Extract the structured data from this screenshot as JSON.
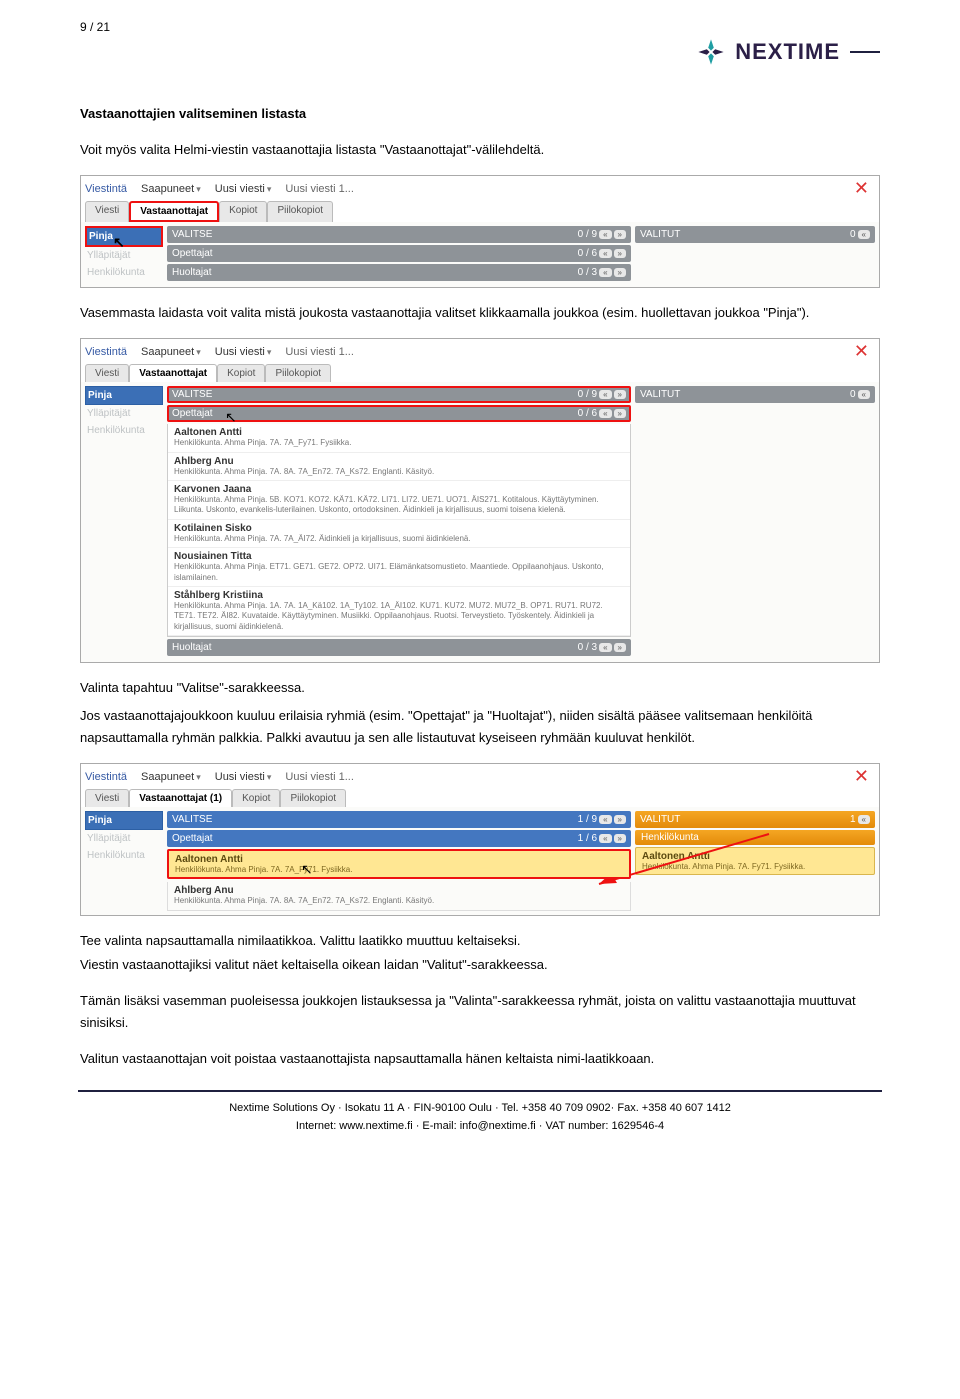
{
  "pagenum": "9 / 21",
  "brand": "NEXTIME",
  "section_title": "Vastaanottajien valitseminen listasta",
  "intro": "Voit myös valita Helmi-viestin vastaanottajia listasta \"Vastaanottajat\"-välilehdeltä.",
  "para2": "Vasemmasta laidasta voit valita mistä joukosta vastaanottajia valitset klikkaamalla joukkoa (esim. huollettavan joukkoa \"Pinja\").",
  "para3a": "Valinta tapahtuu \"Valitse\"-sarakkeessa.",
  "para3b": "Jos vastaanottajajoukkoon kuuluu erilaisia ryhmiä (esim. \"Opettajat\" ja \"Huoltajat\"), niiden sisältä pääsee valitsemaan henkilöitä napsauttamalla ryhmän palkkia. Palkki avautuu ja sen alle listautuvat kyseiseen ryhmään kuuluvat henkilöt.",
  "para4a": "Tee valinta napsauttamalla nimilaatikkoa. Valittu laatikko muuttuu keltaiseksi.",
  "para4b": "Viestin vastaanottajiksi valitut näet keltaisella oikean laidan \"Valitut\"-sarakkeessa.",
  "para5": "Tämän lisäksi vasemman puoleisessa joukkojen listauksessa ja \"Valinta\"-sarakkeessa ryhmät, joista on valittu vastaanottajia muuttuvat sinisiksi.",
  "para6": "Valitun vastaanottajan voit poistaa vastaanottajista napsauttamalla hänen keltaista nimi-laatikkoaan.",
  "ui": {
    "viestinta": "Viestintä",
    "saapuneet": "Saapuneet",
    "uusi": "Uusi viesti",
    "uusi1": "Uusi viesti 1...",
    "viesti": "Viesti",
    "vastaanottajat": "Vastaanottajat",
    "vastaanottajat1": "Vastaanottajat (1)",
    "kopiot": "Kopiot",
    "piilokopiot": "Piilokopiot",
    "valitse": "VALITSE",
    "valitut": "VALITUT",
    "pinja": "Pinja",
    "ylapitajat": "Ylläpitäjät",
    "henkilokunta": "Henkilökunta",
    "opettajat": "Opettajat",
    "huoltajat": "Huoltajat",
    "c09": "0 / 9",
    "c19": "1 / 9",
    "c06": "0 / 6",
    "c16": "1 / 6",
    "c03": "0 / 3",
    "z0": "0",
    "z1": "1"
  },
  "teachers": [
    {
      "name": "Aaltonen Antti",
      "sub": "Henkilökunta. Ahma Pinja. 7A. 7A_Fy71. Fysiikka."
    },
    {
      "name": "Ahlberg Anu",
      "sub": "Henkilökunta. Ahma Pinja. 7A. 8A. 7A_En72. 7A_Ks72. Englanti. Käsityö."
    },
    {
      "name": "Karvonen Jaana",
      "sub": "Henkilökunta. Ahma Pinja. 5B. KO71. KO72. KÄ71. KÄ72. LI71. LI72. UE71. UO71. ÄIS271. Kotitalous. Käyttäytyminen. Liikunta. Uskonto, evankelis-luterilainen. Uskonto, ortodoksinen. Äidinkieli ja kirjallisuus, suomi toisena kielenä."
    },
    {
      "name": "Kotilainen Sisko",
      "sub": "Henkilökunta. Ahma Pinja. 7A. 7A_ÄI72. Äidinkieli ja kirjallisuus, suomi äidinkielenä."
    },
    {
      "name": "Nousiainen Titta",
      "sub": "Henkilökunta. Ahma Pinja. ET71. GE71. GE72. OP72. UI71. Elämänkatsomustieto. Maantiede. Oppilaanohjaus. Uskonto, islamilainen."
    },
    {
      "name": "Ståhlberg Kristiina",
      "sub": "Henkilökunta. Ahma Pinja. 1A. 7A. 1A_Kä102. 1A_Ty102. 1A_ÄI102. KU71. KU72. MU72. MU72_B. OP71. RU71. RU72. TE71. TE72. ÄI82. Kuvataide. Käyttäytyminen. Musiikki. Oppilaanohjaus. Ruotsi. Terveystieto. Työskentely. Äidinkieli ja kirjallisuus, suomi äidinkielenä."
    }
  ],
  "shot3": {
    "aaltonen_name": "Aaltonen Antti",
    "aaltonen_sub": "Henkilökunta. Ahma Pinja. 7A. 7A_Fy71. Fysiikka.",
    "aaltonen_sub_r": "Henkilökunta. Ahma Pinja. 7A. Fy71. Fysiikka.",
    "ahlberg_name": "Ahlberg Anu",
    "ahlberg_sub": "Henkilökunta. Ahma Pinja. 7A. 8A. 7A_En72. 7A_Ks72. Englanti. Käsityö."
  },
  "footer": {
    "line1": "Nextime Solutions Oy · Isokatu 11 A · FIN-90100 Oulu · Tel. +358 40 709 0902· Fax. +358 40 607 1412",
    "line2": "Internet: www.nextime.fi · E-mail: info@nextime.fi · VAT number: 1629546-4"
  }
}
